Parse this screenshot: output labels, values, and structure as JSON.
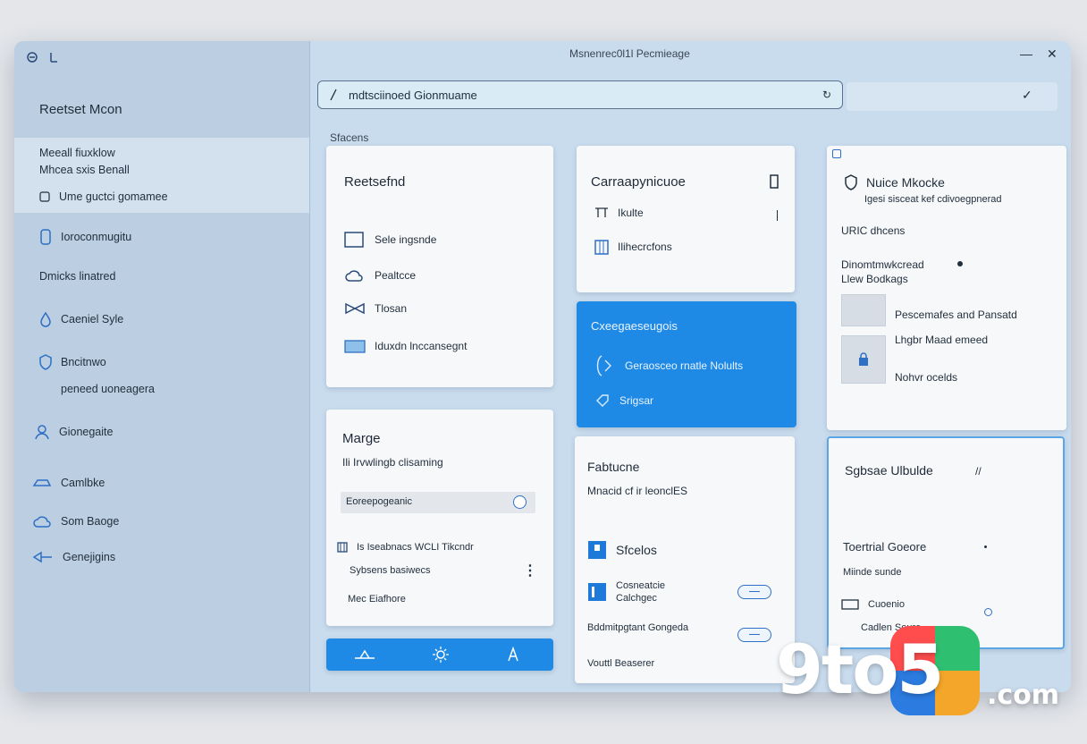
{
  "window": {
    "title": "Msnenrec0l1l Pecmieage"
  },
  "sidebar": {
    "title": "Reetset Mcon",
    "highlight": {
      "line1": "Meeall fiuxklow",
      "line2": "Mhcea sxis Benall",
      "line3": "Ume guctci gomamee"
    },
    "items": [
      {
        "label": "Ioroconmugitu",
        "icon": "phone-icon"
      },
      {
        "label": "Dmicks linatred",
        "icon": ""
      },
      {
        "label": "Caeniel Syle",
        "icon": "drop-icon"
      },
      {
        "label": "Bncitnwo",
        "sub": "peneed uoneagera",
        "icon": "shield-icon"
      },
      {
        "label": "Gionegaite",
        "icon": "user-icon"
      },
      {
        "label": "Camlbke",
        "icon": "car-icon"
      },
      {
        "label": "Som Baoge",
        "icon": "cloud-icon"
      },
      {
        "label": "Genejigins",
        "icon": "arrow-icon"
      }
    ]
  },
  "search": {
    "value": "mdtsciinoed Gionmuame"
  },
  "main": {
    "section_label": "Sfacens"
  },
  "cards": {
    "c1": {
      "title": "Reetsefnd",
      "items": [
        "Sele ingsnde",
        "Pealtcce",
        "Tlosan",
        "Iduxdn lnccansegnt"
      ]
    },
    "c2": {
      "title": "Marge",
      "subtitle": "Ili Irvwlingb clisaming",
      "field": "Eoreepogeanic",
      "row1": "Is Iseabnacs WCLI Tikcndr",
      "row2": "Sybsens basiwecs",
      "row3": "Mec Eiafhore"
    },
    "c3": {
      "title": "Carraapynicuoe",
      "items": [
        "Ikulte",
        "Ilihecrcfons"
      ]
    },
    "c4": {
      "title": "Cxeegaeseugois",
      "items": [
        "Geraosceo rnatle Nolults",
        "Srigsar"
      ]
    },
    "c5": {
      "title": "Fabtucne",
      "subtitle": "Mnacid cf ir leonclES",
      "group_title": "Sfcelos",
      "items": [
        {
          "label": "Cosneatcie",
          "sub": "Calchgec"
        },
        {
          "label": "Bddmitpgtant Gongeda"
        },
        {
          "label": "Vouttl Beaserer"
        }
      ]
    },
    "c6": {
      "title": "Nuice Mkocke",
      "subtitle": "Igesi sisceat kef cdivoegpnerad",
      "meta": "URIC dhcens",
      "line1": "Dinomtmwkcread",
      "line2": "Llew Bodkags",
      "items": [
        "Pescemafes and Pansatd",
        "Lhgbr Maad emeed",
        "Nohvr ocelds"
      ]
    },
    "c7": {
      "title": "Sgbsae Ulbulde",
      "row1": "Toertrial Goeore",
      "row2": "Miinde sunde",
      "row3": "Cuoenio",
      "row4": "Cadlen Seure"
    }
  },
  "watermark": {
    "brand": "9to5",
    "suffix": ".com"
  }
}
